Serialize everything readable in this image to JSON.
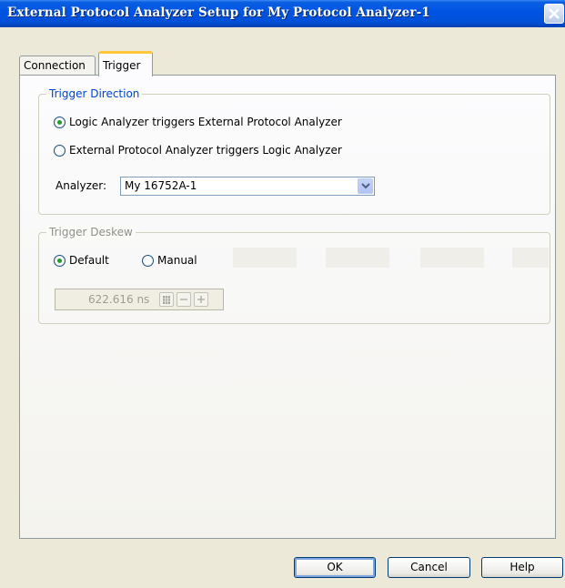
{
  "window": {
    "title": "External Protocol Analyzer Setup for My Protocol Analyzer-1"
  },
  "tabs": [
    {
      "label": "Connection",
      "selected": false
    },
    {
      "label": "Trigger",
      "selected": true
    }
  ],
  "trigger_direction": {
    "legend": "Trigger Direction",
    "options": [
      {
        "label": "Logic Analyzer triggers External Protocol Analyzer",
        "checked": true
      },
      {
        "label": "External Protocol Analyzer triggers Logic Analyzer",
        "checked": false
      }
    ],
    "analyzer_label": "Analyzer:",
    "analyzer_value": "My 16752A-1"
  },
  "trigger_deskew": {
    "legend": "Trigger Deskew",
    "options": [
      {
        "label": "Default",
        "checked": true
      },
      {
        "label": "Manual",
        "checked": false
      }
    ],
    "value": "622.616 ns",
    "enabled": false
  },
  "buttons": {
    "ok": "OK",
    "cancel": "Cancel",
    "help": "Help"
  },
  "colors": {
    "titlebar": "#0054e3",
    "group_legend": "#0046d5",
    "selected_tab_accent": "#ffc83c"
  }
}
